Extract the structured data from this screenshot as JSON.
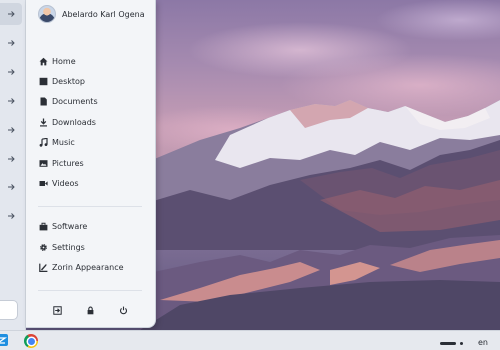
{
  "user": {
    "name": "Abelardo Karl Ogena"
  },
  "places": [
    {
      "label": "Home",
      "icon": "home-icon"
    },
    {
      "label": "Desktop",
      "icon": "desktop-icon"
    },
    {
      "label": "Documents",
      "icon": "document-icon"
    },
    {
      "label": "Downloads",
      "icon": "download-icon"
    },
    {
      "label": "Music",
      "icon": "music-icon"
    },
    {
      "label": "Pictures",
      "icon": "pictures-icon"
    },
    {
      "label": "Videos",
      "icon": "video-icon"
    }
  ],
  "system": [
    {
      "label": "Software",
      "icon": "software-icon"
    },
    {
      "label": "Settings",
      "icon": "gear-icon"
    },
    {
      "label": "Zorin Appearance",
      "icon": "appearance-icon"
    }
  ],
  "power": {
    "buttons": [
      "logout-icon",
      "lock-icon",
      "power-icon"
    ]
  },
  "dock": {
    "items": [
      "chevron-right-icon",
      "chevron-right-icon",
      "chevron-right-icon",
      "chevron-right-icon",
      "chevron-right-icon",
      "chevron-right-icon",
      "chevron-right-icon",
      "chevron-right-icon",
      "chevron-right-icon",
      "chevron-right-icon",
      "chevron-right-icon"
    ]
  },
  "taskbar": {
    "apps": [
      "zorin-menu-icon",
      "chrome-icon"
    ],
    "language": "en"
  },
  "colors": {
    "menu_bg": "#f3f5f8",
    "text": "#2b2f36",
    "taskbar_bg": "#e6e9ee"
  }
}
